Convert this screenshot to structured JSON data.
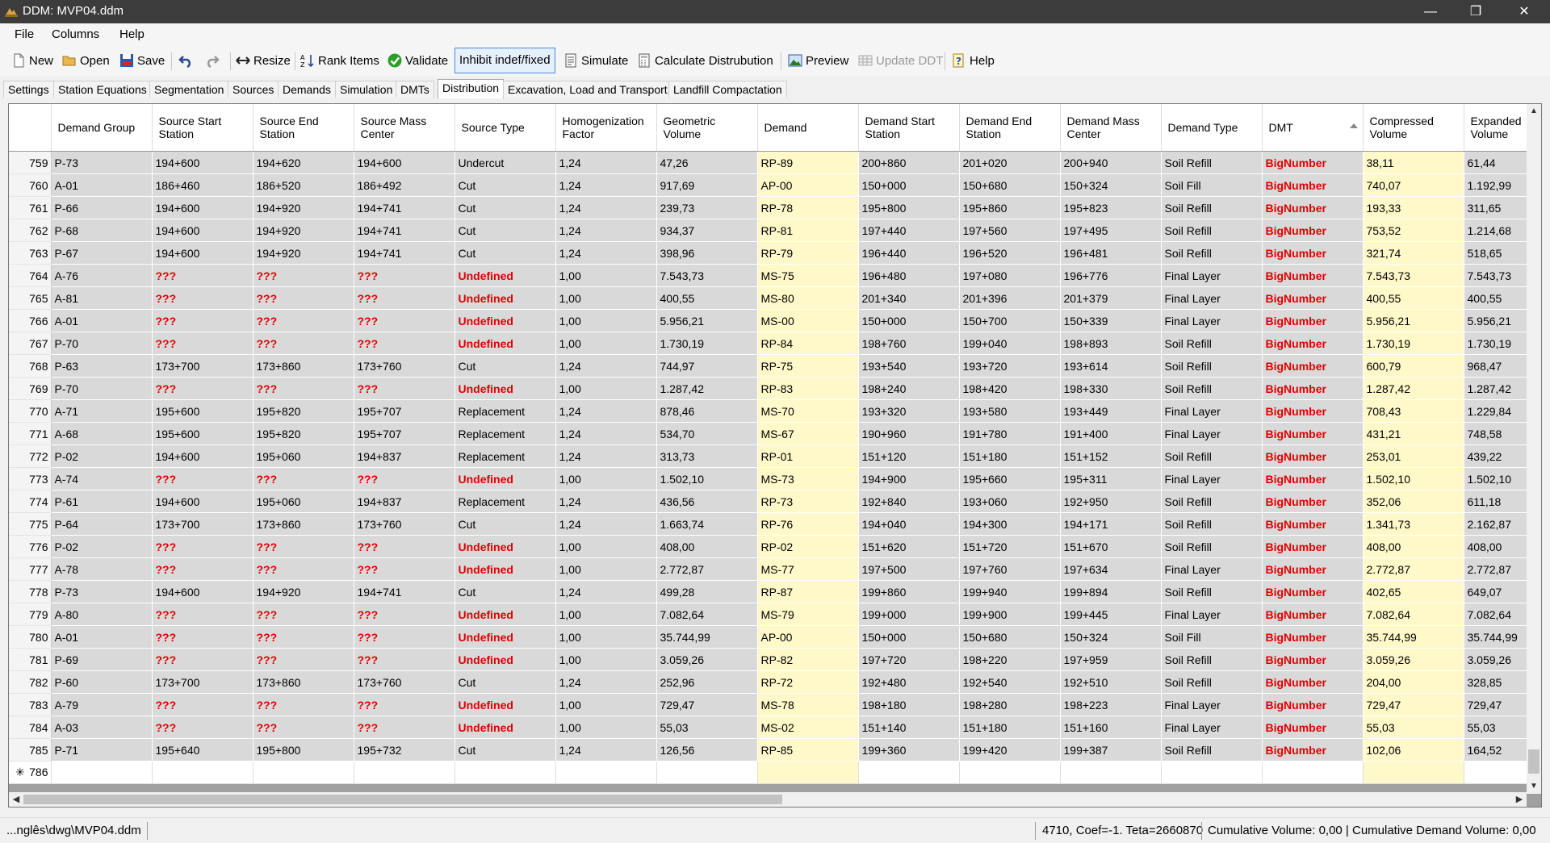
{
  "window": {
    "title": "DDM: MVP04.ddm",
    "minimize": "—",
    "maximize": "❐",
    "close": "✕"
  },
  "menu": [
    "File",
    "Columns",
    "Help"
  ],
  "toolbar": {
    "new": "New",
    "open": "Open",
    "save": "Save",
    "resize": "Resize",
    "rank_items": "Rank Items",
    "validate": "Validate",
    "inhibit": "Inhibit indef/fixed",
    "simulate": "Simulate",
    "calculate": "Calculate Distrubution",
    "preview": "Preview",
    "update_ddt": "Update DDT",
    "help": "Help"
  },
  "tabs": [
    "Settings",
    "Station Equations",
    "Segmentation",
    "Sources",
    "Demands",
    "Simulation",
    "DMTs",
    "Distribution",
    "Excavation, Load and Transport",
    "Landfill Compactation"
  ],
  "active_tab": "Distribution",
  "columns": [
    "Demand Group",
    "Source Start Station",
    "Source End Station",
    "Source Mass Center",
    "Source Type",
    "Homogenization Factor",
    "Geometric Volume",
    "Demand",
    "Demand Start Station",
    "Demand End Station",
    "Demand Mass Center",
    "Demand Type",
    "DMT",
    "Compressed Volume",
    "Expanded Volume"
  ],
  "rows": [
    [
      "759",
      "P-73",
      "194+600",
      "194+620",
      "194+600",
      "Undercut",
      "1,24",
      "47,26",
      "RP-89",
      "200+860",
      "201+020",
      "200+940",
      "Soil Refill",
      "BigNumber",
      "38,11",
      "61,44"
    ],
    [
      "760",
      "A-01",
      "186+460",
      "186+520",
      "186+492",
      "Cut",
      "1,24",
      "917,69",
      "AP-00",
      "150+000",
      "150+680",
      "150+324",
      "Soil Fill",
      "BigNumber",
      "740,07",
      "1.192,99"
    ],
    [
      "761",
      "P-66",
      "194+600",
      "194+920",
      "194+741",
      "Cut",
      "1,24",
      "239,73",
      "RP-78",
      "195+800",
      "195+860",
      "195+823",
      "Soil Refill",
      "BigNumber",
      "193,33",
      "311,65"
    ],
    [
      "762",
      "P-68",
      "194+600",
      "194+920",
      "194+741",
      "Cut",
      "1,24",
      "934,37",
      "RP-81",
      "197+440",
      "197+560",
      "197+495",
      "Soil Refill",
      "BigNumber",
      "753,52",
      "1.214,68"
    ],
    [
      "763",
      "P-67",
      "194+600",
      "194+920",
      "194+741",
      "Cut",
      "1,24",
      "398,96",
      "RP-79",
      "196+440",
      "196+520",
      "196+481",
      "Soil Refill",
      "BigNumber",
      "321,74",
      "518,65"
    ],
    [
      "764",
      "A-76",
      "???",
      "???",
      "???",
      "Undefined",
      "1,00",
      "7.543,73",
      "MS-75",
      "196+480",
      "197+080",
      "196+776",
      "Final Layer",
      "BigNumber",
      "7.543,73",
      "7.543,73"
    ],
    [
      "765",
      "A-81",
      "???",
      "???",
      "???",
      "Undefined",
      "1,00",
      "400,55",
      "MS-80",
      "201+340",
      "201+396",
      "201+379",
      "Final Layer",
      "BigNumber",
      "400,55",
      "400,55"
    ],
    [
      "766",
      "A-01",
      "???",
      "???",
      "???",
      "Undefined",
      "1,00",
      "5.956,21",
      "MS-00",
      "150+000",
      "150+700",
      "150+339",
      "Final Layer",
      "BigNumber",
      "5.956,21",
      "5.956,21"
    ],
    [
      "767",
      "P-70",
      "???",
      "???",
      "???",
      "Undefined",
      "1,00",
      "1.730,19",
      "RP-84",
      "198+760",
      "199+040",
      "198+893",
      "Soil Refill",
      "BigNumber",
      "1.730,19",
      "1.730,19"
    ],
    [
      "768",
      "P-63",
      "173+700",
      "173+860",
      "173+760",
      "Cut",
      "1,24",
      "744,97",
      "RP-75",
      "193+540",
      "193+720",
      "193+614",
      "Soil Refill",
      "BigNumber",
      "600,79",
      "968,47"
    ],
    [
      "769",
      "P-70",
      "???",
      "???",
      "???",
      "Undefined",
      "1,00",
      "1.287,42",
      "RP-83",
      "198+240",
      "198+420",
      "198+330",
      "Soil Refill",
      "BigNumber",
      "1.287,42",
      "1.287,42"
    ],
    [
      "770",
      "A-71",
      "195+600",
      "195+820",
      "195+707",
      "Replacement",
      "1,24",
      "878,46",
      "MS-70",
      "193+320",
      "193+580",
      "193+449",
      "Final Layer",
      "BigNumber",
      "708,43",
      "1.229,84"
    ],
    [
      "771",
      "A-68",
      "195+600",
      "195+820",
      "195+707",
      "Replacement",
      "1,24",
      "534,70",
      "MS-67",
      "190+960",
      "191+780",
      "191+400",
      "Final Layer",
      "BigNumber",
      "431,21",
      "748,58"
    ],
    [
      "772",
      "P-02",
      "194+600",
      "195+060",
      "194+837",
      "Replacement",
      "1,24",
      "313,73",
      "RP-01",
      "151+120",
      "151+180",
      "151+152",
      "Soil Refill",
      "BigNumber",
      "253,01",
      "439,22"
    ],
    [
      "773",
      "A-74",
      "???",
      "???",
      "???",
      "Undefined",
      "1,00",
      "1.502,10",
      "MS-73",
      "194+900",
      "195+660",
      "195+311",
      "Final Layer",
      "BigNumber",
      "1.502,10",
      "1.502,10"
    ],
    [
      "774",
      "P-61",
      "194+600",
      "195+060",
      "194+837",
      "Replacement",
      "1,24",
      "436,56",
      "RP-73",
      "192+840",
      "193+060",
      "192+950",
      "Soil Refill",
      "BigNumber",
      "352,06",
      "611,18"
    ],
    [
      "775",
      "P-64",
      "173+700",
      "173+860",
      "173+760",
      "Cut",
      "1,24",
      "1.663,74",
      "RP-76",
      "194+040",
      "194+300",
      "194+171",
      "Soil Refill",
      "BigNumber",
      "1.341,73",
      "2.162,87"
    ],
    [
      "776",
      "P-02",
      "???",
      "???",
      "???",
      "Undefined",
      "1,00",
      "408,00",
      "RP-02",
      "151+620",
      "151+720",
      "151+670",
      "Soil Refill",
      "BigNumber",
      "408,00",
      "408,00"
    ],
    [
      "777",
      "A-78",
      "???",
      "???",
      "???",
      "Undefined",
      "1,00",
      "2.772,87",
      "MS-77",
      "197+500",
      "197+760",
      "197+634",
      "Final Layer",
      "BigNumber",
      "2.772,87",
      "2.772,87"
    ],
    [
      "778",
      "P-73",
      "194+600",
      "194+920",
      "194+741",
      "Cut",
      "1,24",
      "499,28",
      "RP-87",
      "199+860",
      "199+940",
      "199+894",
      "Soil Refill",
      "BigNumber",
      "402,65",
      "649,07"
    ],
    [
      "779",
      "A-80",
      "???",
      "???",
      "???",
      "Undefined",
      "1,00",
      "7.082,64",
      "MS-79",
      "199+000",
      "199+900",
      "199+445",
      "Final Layer",
      "BigNumber",
      "7.082,64",
      "7.082,64"
    ],
    [
      "780",
      "A-01",
      "???",
      "???",
      "???",
      "Undefined",
      "1,00",
      "35.744,99",
      "AP-00",
      "150+000",
      "150+680",
      "150+324",
      "Soil Fill",
      "BigNumber",
      "35.744,99",
      "35.744,99"
    ],
    [
      "781",
      "P-69",
      "???",
      "???",
      "???",
      "Undefined",
      "1,00",
      "3.059,26",
      "RP-82",
      "197+720",
      "198+220",
      "197+959",
      "Soil Refill",
      "BigNumber",
      "3.059,26",
      "3.059,26"
    ],
    [
      "782",
      "P-60",
      "173+700",
      "173+860",
      "173+760",
      "Cut",
      "1,24",
      "252,96",
      "RP-72",
      "192+480",
      "192+540",
      "192+510",
      "Soil Refill",
      "BigNumber",
      "204,00",
      "328,85"
    ],
    [
      "783",
      "A-79",
      "???",
      "???",
      "???",
      "Undefined",
      "1,00",
      "729,47",
      "MS-78",
      "198+180",
      "198+280",
      "198+223",
      "Final Layer",
      "BigNumber",
      "729,47",
      "729,47"
    ],
    [
      "784",
      "A-03",
      "???",
      "???",
      "???",
      "Undefined",
      "1,00",
      "55,03",
      "MS-02",
      "151+140",
      "151+180",
      "151+160",
      "Final Layer",
      "BigNumber",
      "55,03",
      "55,03"
    ],
    [
      "785",
      "P-71",
      "195+640",
      "195+800",
      "195+732",
      "Cut",
      "1,24",
      "126,56",
      "RP-85",
      "199+360",
      "199+420",
      "199+387",
      "Soil Refill",
      "BigNumber",
      "102,06",
      "164,52"
    ]
  ],
  "new_row_number": "786",
  "new_row_marker": "✳",
  "status": {
    "path": "...nglês\\dwg\\MVP04.ddm",
    "coords": "4710, Coef=-1. Teta=2660870",
    "cumulative": "Cumulative Volume: 0,00 | Cumulative Demand Volume: 0,00"
  },
  "colors": {
    "title_bar": "#3c3c3c",
    "error_red": "#e00000",
    "demand_highlight": "#fff8c8",
    "grid_cell": "#d9d9d9"
  }
}
